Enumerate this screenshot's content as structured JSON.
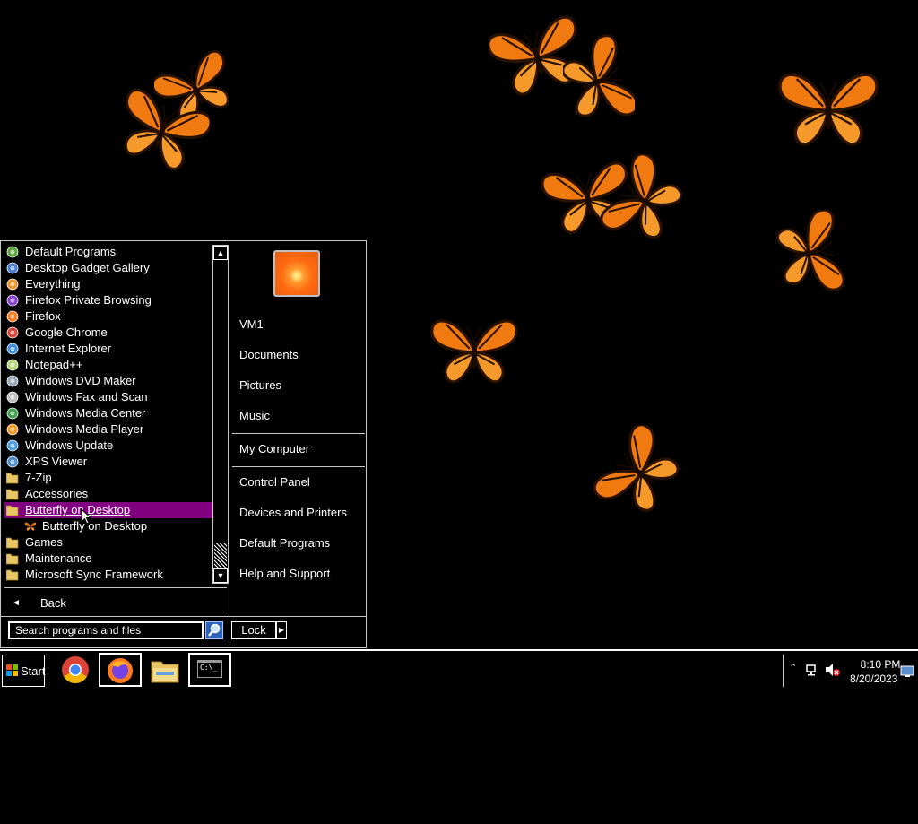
{
  "start_menu": {
    "programs": [
      {
        "label": "Default Programs",
        "icon": "default-programs-icon"
      },
      {
        "label": "Desktop Gadget Gallery",
        "icon": "gadget-gallery-icon"
      },
      {
        "label": "Everything",
        "icon": "everything-search-icon"
      },
      {
        "label": "Firefox Private Browsing",
        "icon": "firefox-private-icon"
      },
      {
        "label": "Firefox",
        "icon": "firefox-icon"
      },
      {
        "label": "Google Chrome",
        "icon": "chrome-icon"
      },
      {
        "label": "Internet Explorer",
        "icon": "internet-explorer-icon"
      },
      {
        "label": "Notepad++",
        "icon": "notepadpp-icon"
      },
      {
        "label": "Windows DVD Maker",
        "icon": "dvd-maker-icon"
      },
      {
        "label": "Windows Fax and Scan",
        "icon": "fax-scan-icon"
      },
      {
        "label": "Windows Media Center",
        "icon": "media-center-icon"
      },
      {
        "label": "Windows Media Player",
        "icon": "media-player-icon"
      },
      {
        "label": "Windows Update",
        "icon": "windows-update-icon"
      },
      {
        "label": "XPS Viewer",
        "icon": "xps-viewer-icon"
      },
      {
        "label": "7-Zip",
        "icon": "folder-icon"
      },
      {
        "label": "Accessories",
        "icon": "folder-icon"
      },
      {
        "label": "Butterfly on Desktop",
        "icon": "folder-icon",
        "selected": true
      },
      {
        "label": "Butterfly on Desktop",
        "icon": "butterfly-icon",
        "sub": true
      },
      {
        "label": "Games",
        "icon": "folder-icon"
      },
      {
        "label": "Maintenance",
        "icon": "folder-icon"
      },
      {
        "label": "Microsoft Sync Framework",
        "icon": "folder-icon"
      }
    ],
    "back_label": "Back",
    "search_placeholder": "Search programs and files",
    "lock_label": "Lock",
    "right_links": {
      "user": "VM1",
      "documents": "Documents",
      "pictures": "Pictures",
      "music": "Music",
      "computer": "My Computer",
      "control_panel": "Control Panel",
      "devices": "Devices and Printers",
      "default_programs": "Default Programs",
      "help": "Help and Support"
    }
  },
  "taskbar": {
    "start_label": "Start",
    "apps": [
      "chrome-icon",
      "firefox-icon",
      "file-explorer-icon",
      "command-prompt-icon"
    ],
    "cmd_text": "C:\\_",
    "clock_time": "8:10 PM",
    "clock_date": "8/20/2023"
  },
  "colors": {
    "selection": "#800080",
    "butterfly_orange": "#f07a10",
    "butterfly_dark": "#2a1200"
  }
}
